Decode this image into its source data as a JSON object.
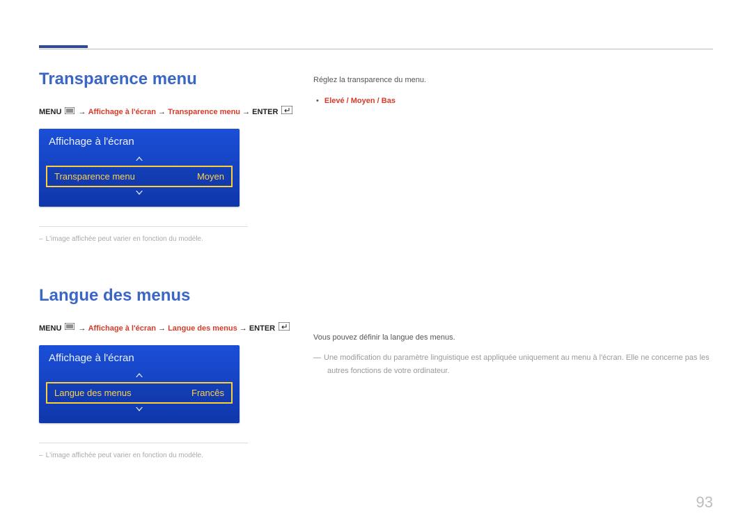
{
  "page_number": "93",
  "section1": {
    "heading": "Transparence menu",
    "path": {
      "prefix": "MENU",
      "arrow": "→",
      "step1": "Affichage à l'écran",
      "step2": "Transparence menu",
      "suffix": "ENTER"
    },
    "osd": {
      "title": "Affichage à l'écran",
      "item_label": "Transparence menu",
      "item_value": "Moyen"
    },
    "footnote": "L'image affichée peut varier en fonction du modèle.",
    "right": {
      "line": "Réglez la transparence du menu.",
      "options": "Elevé / Moyen / Bas"
    }
  },
  "section2": {
    "heading": "Langue des menus",
    "path": {
      "prefix": "MENU",
      "arrow": "→",
      "step1": "Affichage à l'écran",
      "step2": "Langue des menus",
      "suffix": "ENTER"
    },
    "osd": {
      "title": "Affichage à l'écran",
      "item_label": "Langue des menus",
      "item_value": "Francês"
    },
    "footnote": "L'image affichée peut varier en fonction du modèle.",
    "right": {
      "line": "Vous pouvez définir la langue des menus.",
      "note": "Une modification du paramètre linguistique est appliquée uniquement au menu à l'écran. Elle ne concerne pas les autres fonctions de votre ordinateur."
    }
  }
}
